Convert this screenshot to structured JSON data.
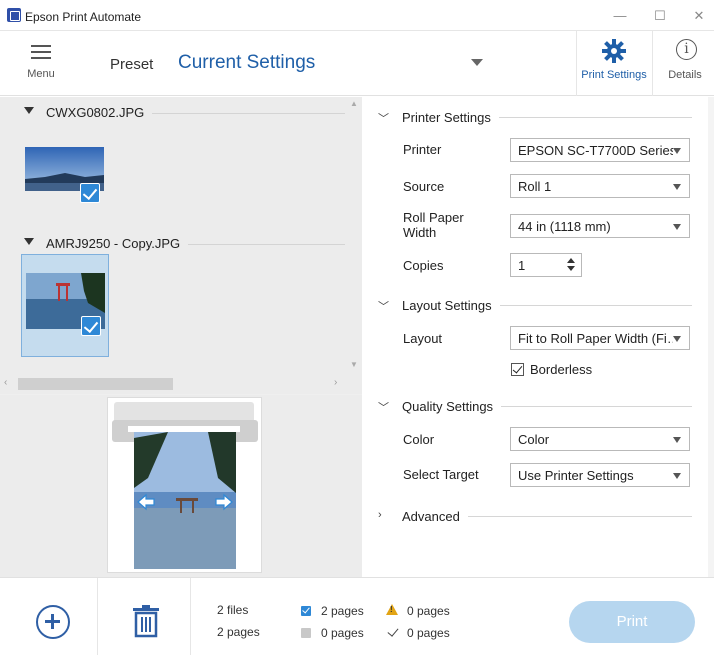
{
  "window": {
    "title": "Epson Print Automate",
    "controls": [
      "—",
      "☐",
      "✕"
    ]
  },
  "toolbar": {
    "menu_label": "Menu",
    "preset_label": "Preset",
    "preset_value": "Current Settings",
    "print_settings_label": "Print Settings",
    "details_label": "Details"
  },
  "files": [
    {
      "name": "CWXG0802.JPG",
      "checked": true,
      "selected": false
    },
    {
      "name": "AMRJ9250 - Copy.JPG",
      "checked": true,
      "selected": true
    }
  ],
  "settings": {
    "printer_section": "Printer Settings",
    "printer_label": "Printer",
    "printer_value": "EPSON SC-T7700D Series",
    "source_label": "Source",
    "source_value": "Roll 1",
    "roll_width_label": "Roll Paper Width",
    "roll_width_value": "44 in (1118 mm)",
    "copies_label": "Copies",
    "copies_value": "1",
    "layout_section": "Layout Settings",
    "layout_label": "Layout",
    "layout_value": "Fit to Roll Paper Width (Fi…",
    "borderless_label": "Borderless",
    "borderless_checked": true,
    "quality_section": "Quality Settings",
    "color_label": "Color",
    "color_value": "Color",
    "target_label": "Select Target",
    "target_value": "Use Printer Settings",
    "advanced_section": "Advanced"
  },
  "footer": {
    "files_count": "2 files",
    "pages_count": "2 pages",
    "checked_pages": "2 pages",
    "warning_pages": "0 pages",
    "unchecked_pages": "0 pages",
    "done_pages": "0 pages",
    "print_label": "Print"
  },
  "colors": {
    "accent": "#1f5fa8",
    "check_blue": "#2e88d6",
    "print_button": "#b6d6ef",
    "warning": "#e2a414"
  }
}
